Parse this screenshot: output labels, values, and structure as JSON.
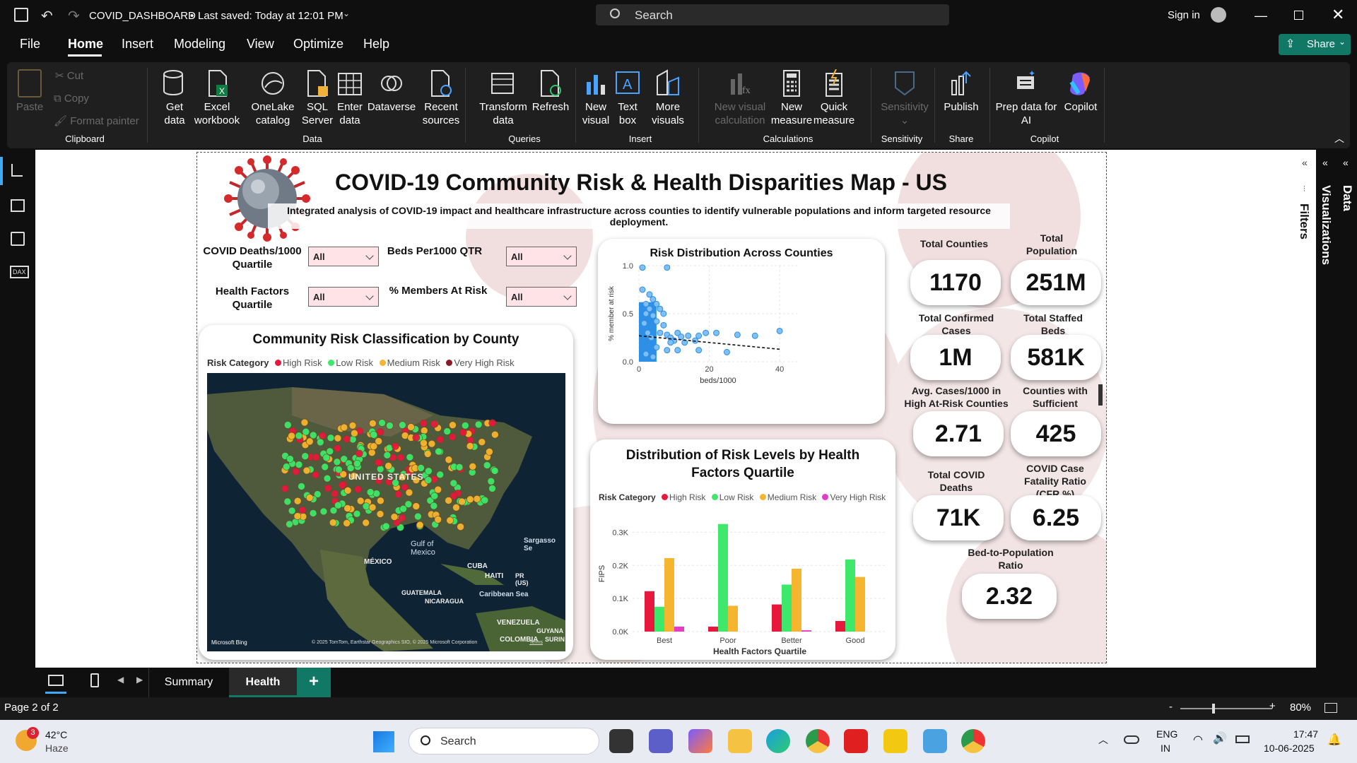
{
  "app": {
    "file_title": "COVID_DASHBOARD",
    "save_status": "Last saved: Today at 12:01 PM",
    "search_placeholder": "Search",
    "sign_in": "Sign in"
  },
  "menu": {
    "items": [
      "File",
      "Home",
      "Insert",
      "Modeling",
      "View",
      "Optimize",
      "Help"
    ],
    "active": "Home",
    "share": "Share"
  },
  "ribbon": {
    "clipboard": {
      "paste": "Paste",
      "cut": "Cut",
      "copy": "Copy",
      "format_painter": "Format painter",
      "group": "Clipboard"
    },
    "data": {
      "get_data": "Get\ndata",
      "excel": "Excel\nworkbook",
      "onelake": "OneLake\ncatalog",
      "sql": "SQL\nServer",
      "enter": "Enter\ndata",
      "dataverse": "Dataverse",
      "recent": "Recent\nsources",
      "group": "Data"
    },
    "queries": {
      "transform": "Transform\ndata",
      "refresh": "Refresh",
      "group": "Queries"
    },
    "insert": {
      "new_visual": "New\nvisual",
      "text_box": "Text\nbox",
      "more_visuals": "More\nvisuals",
      "group": "Insert"
    },
    "calculations": {
      "new_visual_calc": "New visual\ncalculation",
      "new_measure": "New\nmeasure",
      "quick_measure": "Quick\nmeasure",
      "group": "Calculations"
    },
    "sensitivity": {
      "label": "Sensitivity",
      "group": "Sensitivity"
    },
    "share": {
      "publish": "Publish",
      "group": "Share"
    },
    "copilot": {
      "prep": "Prep data for\nAI",
      "copilot": "Copilot",
      "group": "Copilot"
    }
  },
  "report": {
    "title": "COVID-19 Community Risk & Health Disparities Map - US",
    "subtitle": "Integrated analysis of COVID-19 impact and healthcare infrastructure across counties to identify vulnerable populations and inform targeted resource deployment.",
    "slicers": [
      {
        "label": "COVID Deaths/1000\nQuartile",
        "value": "All"
      },
      {
        "label": "Beds Per1000 QTR",
        "value": "All"
      },
      {
        "label": "Health Factors\nQuartile",
        "value": "All"
      },
      {
        "label": "% Members At Risk",
        "value": "All"
      }
    ],
    "map": {
      "title": "Community Risk Classification by County",
      "legend_title": "Risk Category",
      "legend": [
        "High Risk",
        "Low Risk",
        "Medium Risk",
        "Very High Risk"
      ],
      "labels": [
        "UNITED STATES",
        "Gulf of\nMexico",
        "MÉXICO",
        "CUBA",
        "HAITI",
        "PR\n(US)",
        "Sargasso Se",
        "Caribbean Sea",
        "GUATEMALA",
        "NICARAGUA",
        "VENEZUELA",
        "GUYANA",
        "COLOMBIA",
        "SURIN"
      ],
      "attribution": "© 2025 TomTom, Earthstar Geographics SIO, © 2025 Microsoft Corporation",
      "terms": "Terms",
      "brand": "Microsoft Bing"
    },
    "kpis": [
      {
        "label": "Total Counties",
        "value": "1170"
      },
      {
        "label": "Total\nPopulation",
        "value": "251M"
      },
      {
        "label": "Total Confirmed\nCases",
        "value": "1M"
      },
      {
        "label": "Total Staffed\nBeds",
        "value": "581K"
      },
      {
        "label": "Avg. Cases/1000 in\nHigh At-Risk Counties",
        "value": "2.71"
      },
      {
        "label": "Counties with\nSufficient",
        "value": "425"
      },
      {
        "label": "Total COVID\nDeaths",
        "value": "71K"
      },
      {
        "label": "COVID Case\nFatality Ratio\n(CFR %)",
        "value": "6.25"
      },
      {
        "label": "Bed-to-Population\nRatio",
        "value": "2.32"
      }
    ]
  },
  "chart_data": [
    {
      "type": "scatter",
      "title": "Risk Distribution Across Counties",
      "xlabel": "beds/1000",
      "ylabel": "% member at risk",
      "xlim": [
        0,
        45
      ],
      "ylim": [
        0,
        1
      ],
      "xticks": [
        "0",
        "20",
        "40"
      ],
      "yticks": [
        "0.0",
        "0.5",
        "1.0"
      ],
      "trendline": true,
      "points": [
        [
          1,
          0.98
        ],
        [
          8,
          0.98
        ],
        [
          1,
          0.75
        ],
        [
          2,
          0.6
        ],
        [
          3,
          0.55
        ],
        [
          4,
          0.48
        ],
        [
          5,
          0.42
        ],
        [
          7,
          0.38
        ],
        [
          1.5,
          0.4
        ],
        [
          2.5,
          0.3
        ],
        [
          3.5,
          0.25
        ],
        [
          6,
          0.3
        ],
        [
          8,
          0.28
        ],
        [
          9,
          0.25
        ],
        [
          10,
          0.22
        ],
        [
          11,
          0.3
        ],
        [
          12,
          0.26
        ],
        [
          13,
          0.2
        ],
        [
          14,
          0.27
        ],
        [
          16,
          0.22
        ],
        [
          17,
          0.27
        ],
        [
          19,
          0.3
        ],
        [
          22,
          0.3
        ],
        [
          28,
          0.28
        ],
        [
          33,
          0.27
        ],
        [
          40,
          0.32
        ],
        [
          5,
          0.6
        ],
        [
          6,
          0.55
        ],
        [
          3,
          0.7
        ],
        [
          4,
          0.65
        ],
        [
          2,
          0.5
        ],
        [
          7,
          0.5
        ],
        [
          9,
          0.2
        ],
        [
          5,
          0.15
        ],
        [
          8,
          0.12
        ],
        [
          11,
          0.12
        ],
        [
          4,
          0.05
        ],
        [
          2,
          0.08
        ],
        [
          17,
          0.12
        ],
        [
          25,
          0.1
        ]
      ],
      "trend": [
        [
          0,
          0.27
        ],
        [
          40,
          0.13
        ]
      ]
    },
    {
      "type": "bar",
      "title": "Distribution of Risk Levels by Health Factors Quartile",
      "xlabel": "Health Factors Quartile",
      "ylabel": "FIPS",
      "ylim": [
        0,
        0.35
      ],
      "yticks": [
        "0.0K",
        "0.1K",
        "0.2K",
        "0.3K"
      ],
      "legend_title": "Risk Category",
      "categories": [
        "Best",
        "Poor",
        "Better",
        "Good"
      ],
      "series": [
        {
          "name": "High Risk",
          "color": "#e8173c",
          "values": [
            0.122,
            0.015,
            0.082,
            0.032
          ]
        },
        {
          "name": "Low Risk",
          "color": "#3de86a",
          "values": [
            0.075,
            0.325,
            0.142,
            0.218
          ]
        },
        {
          "name": "Medium Risk",
          "color": "#f5b52e",
          "values": [
            0.222,
            0.078,
            0.19,
            0.165
          ]
        },
        {
          "name": "Very High Risk",
          "color": "#e83ac8",
          "values": [
            0.015,
            0,
            0.004,
            0
          ]
        }
      ]
    }
  ],
  "pages": {
    "tabs": [
      "Summary",
      "Health"
    ],
    "active": "Health",
    "add": "+"
  },
  "status": {
    "page": "Page 2 of 2",
    "zoom": "80%",
    "zoom_minus": "-",
    "zoom_plus": "+"
  },
  "panes": {
    "filters": "Filters",
    "visualizations": "Visualizations",
    "data": "Data"
  },
  "taskbar": {
    "temp": "42°C",
    "weather": "Haze",
    "badge": "3",
    "search": "Search",
    "lang1": "ENG",
    "lang2": "IN",
    "time": "17:47",
    "date": "10-06-2025"
  }
}
